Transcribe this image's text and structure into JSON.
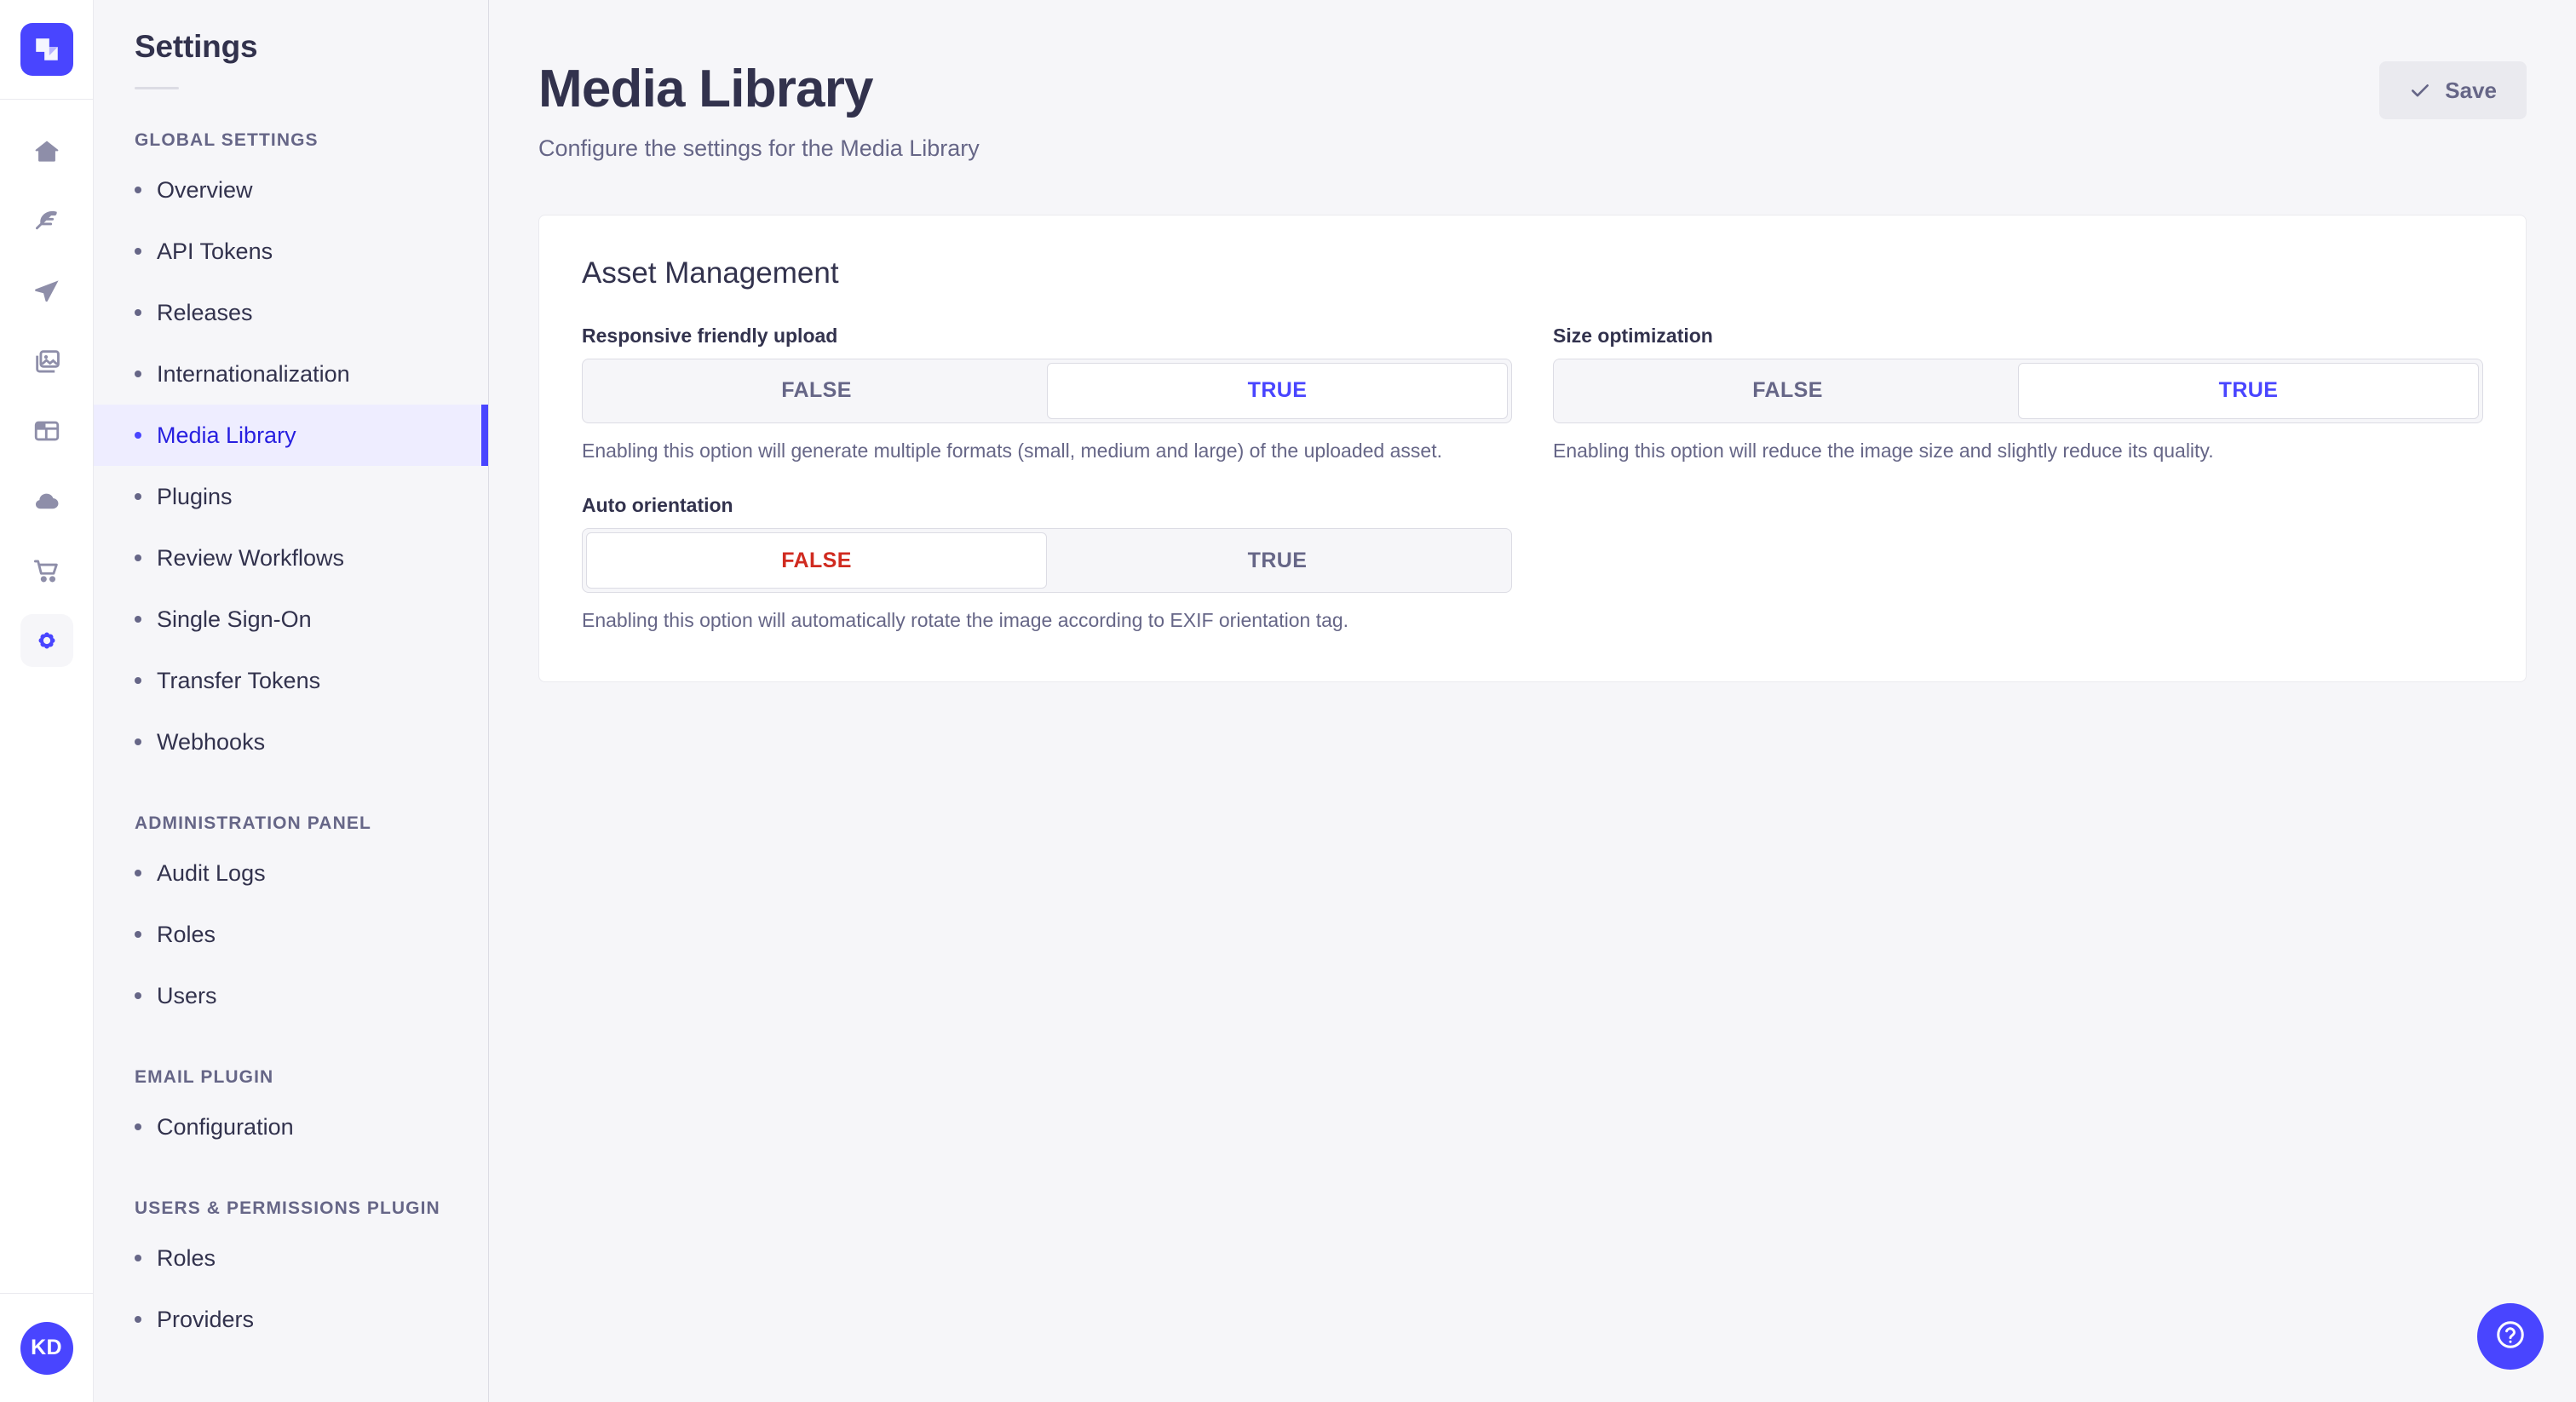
{
  "rail": {
    "logo_icon": "strapi-logo-icon",
    "items": [
      {
        "icon": "home-icon",
        "name": "home",
        "active": false
      },
      {
        "icon": "feather-icon",
        "name": "content-manager",
        "active": false
      },
      {
        "icon": "paper-plane-icon",
        "name": "content-type-builder",
        "active": false
      },
      {
        "icon": "images-icon",
        "name": "media-library",
        "active": false
      },
      {
        "icon": "layout-icon",
        "name": "pages",
        "active": false
      },
      {
        "icon": "cloud-icon",
        "name": "cloud",
        "active": false
      },
      {
        "icon": "shopping-cart-icon",
        "name": "marketplace",
        "active": false
      },
      {
        "icon": "gear-icon",
        "name": "settings",
        "active": true
      }
    ],
    "avatar_initials": "KD"
  },
  "sidebar": {
    "title": "Settings",
    "sections": [
      {
        "title": "GLOBAL SETTINGS",
        "items": [
          {
            "label": "Overview",
            "active": false
          },
          {
            "label": "API Tokens",
            "active": false
          },
          {
            "label": "Releases",
            "active": false
          },
          {
            "label": "Internationalization",
            "active": false
          },
          {
            "label": "Media Library",
            "active": true
          },
          {
            "label": "Plugins",
            "active": false
          },
          {
            "label": "Review Workflows",
            "active": false
          },
          {
            "label": "Single Sign-On",
            "active": false
          },
          {
            "label": "Transfer Tokens",
            "active": false
          },
          {
            "label": "Webhooks",
            "active": false
          }
        ]
      },
      {
        "title": "ADMINISTRATION PANEL",
        "items": [
          {
            "label": "Audit Logs",
            "active": false
          },
          {
            "label": "Roles",
            "active": false
          },
          {
            "label": "Users",
            "active": false
          }
        ]
      },
      {
        "title": "EMAIL PLUGIN",
        "items": [
          {
            "label": "Configuration",
            "active": false
          }
        ]
      },
      {
        "title": "USERS & PERMISSIONS PLUGIN",
        "items": [
          {
            "label": "Roles",
            "active": false
          },
          {
            "label": "Providers",
            "active": false
          }
        ]
      }
    ]
  },
  "header": {
    "title": "Media Library",
    "subtitle": "Configure the settings for the Media Library",
    "save_label": "Save",
    "save_icon": "check-icon",
    "save_disabled": true
  },
  "card": {
    "title": "Asset Management",
    "fields": [
      {
        "label": "Responsive friendly upload",
        "options": [
          "FALSE",
          "TRUE"
        ],
        "value": "TRUE",
        "hint": "Enabling this option will generate multiple formats (small, medium and large) of the uploaded asset."
      },
      {
        "label": "Size optimization",
        "options": [
          "FALSE",
          "TRUE"
        ],
        "value": "TRUE",
        "hint": "Enabling this option will reduce the image size and slightly reduce its quality."
      },
      {
        "label": "Auto orientation",
        "options": [
          "FALSE",
          "TRUE"
        ],
        "value": "FALSE",
        "hint": "Enabling this option will automatically rotate the image according to EXIF orientation tag."
      }
    ]
  },
  "help": {
    "icon": "question-mark-circle-icon",
    "label": "Help"
  },
  "colors": {
    "brand": "#4945ff",
    "brand_text": "#271fe0",
    "danger": "#d02b20",
    "page_bg": "#f6f6f9",
    "card_bg": "#ffffff",
    "text_primary": "#32324d",
    "text_muted": "#666687",
    "border": "#dcdce4",
    "active_bg": "#eeedff"
  }
}
